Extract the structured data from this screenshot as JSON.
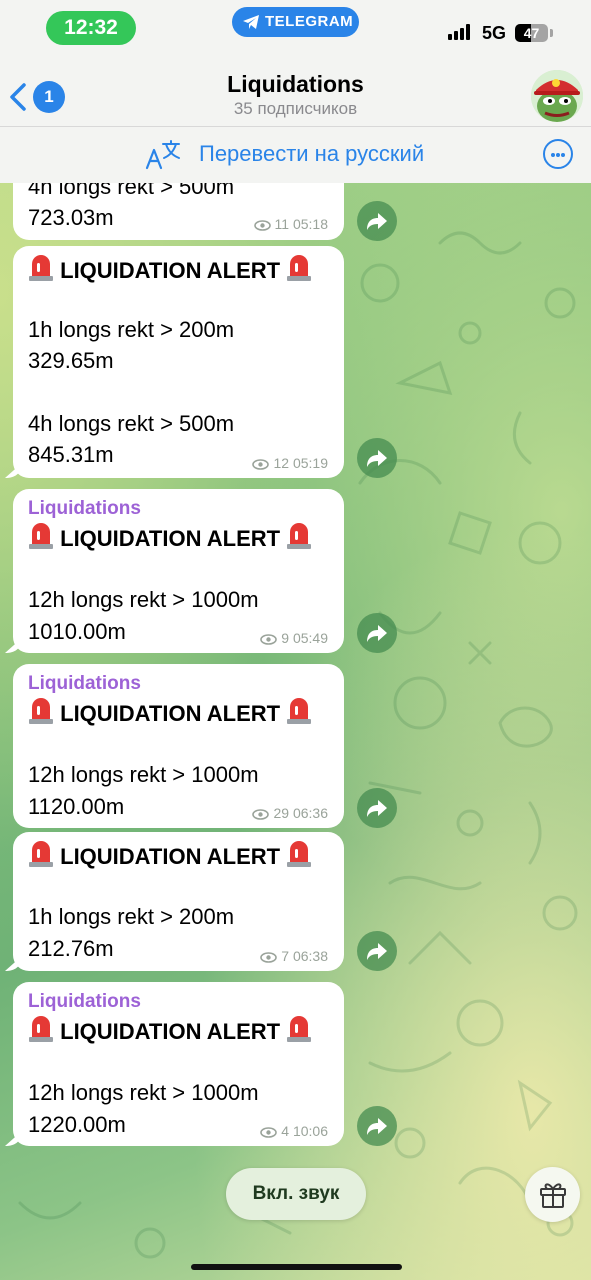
{
  "status_bar": {
    "time": "12:32",
    "app_pill": "TELEGRAM",
    "network": "5G",
    "battery_level": "47"
  },
  "header": {
    "back_badge": "1",
    "title": "Liquidations",
    "subtitle": "35 подписчиков",
    "translate_label": "Перевести на русский"
  },
  "messages": [
    {
      "sender": "",
      "lines": [
        "4h longs rekt > 500m",
        "723.03m"
      ],
      "views": "11",
      "time": "05:18"
    },
    {
      "sender": "",
      "alert": "LIQUIDATION ALERT",
      "lines": [
        "1h longs rekt > 200m",
        "329.65m",
        "4h longs rekt > 500m",
        "845.31m"
      ],
      "views": "12",
      "time": "05:19"
    },
    {
      "sender": "Liquidations",
      "alert": "LIQUIDATION ALERT",
      "lines": [
        "12h longs rekt > 1000m",
        "1010.00m"
      ],
      "views": "9",
      "time": "05:49"
    },
    {
      "sender": "Liquidations",
      "alert": "LIQUIDATION ALERT",
      "lines": [
        "12h longs rekt > 1000m",
        "1120.00m"
      ],
      "views": "29",
      "time": "06:36"
    },
    {
      "sender": "",
      "alert": "LIQUIDATION ALERT",
      "lines": [
        "1h longs rekt > 200m",
        "212.76m"
      ],
      "views": "7",
      "time": "06:38"
    },
    {
      "sender": "Liquidations",
      "alert": "LIQUIDATION ALERT",
      "lines": [
        "12h longs rekt > 1000m",
        "1220.00m"
      ],
      "views": "4",
      "time": "10:06"
    }
  ],
  "bottom": {
    "sound_button": "Вкл. звук"
  },
  "colors": {
    "accent": "#2a84e8",
    "sender_name": "#9d62d6",
    "time_pill": "#34c759"
  }
}
